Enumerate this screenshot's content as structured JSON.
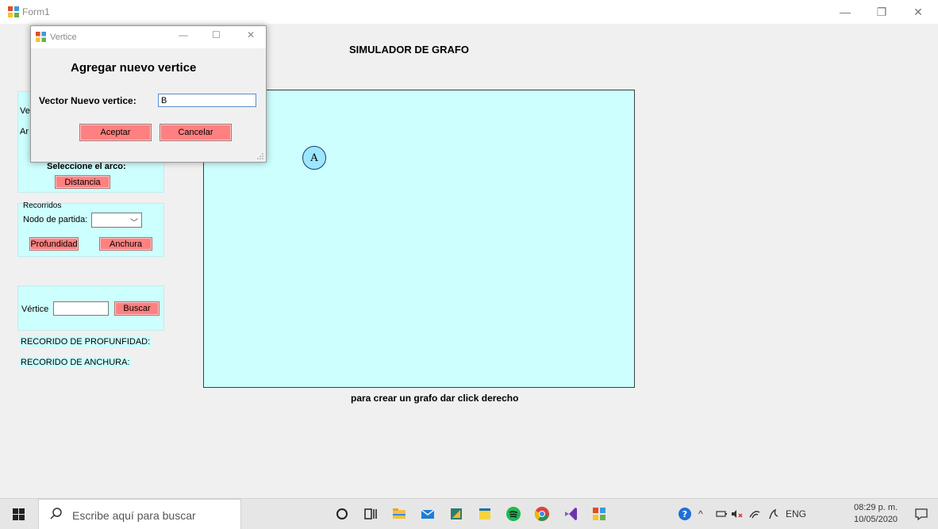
{
  "main_window": {
    "title": "Form1",
    "heading": "SIMULADOR DE GRAFO",
    "hint": "para crear un grafo dar click derecho",
    "min_glyph": "—",
    "max_glyph": "❐",
    "close_glyph": "✕"
  },
  "graph": {
    "nodes": [
      {
        "label": "A"
      }
    ]
  },
  "left_panel": {
    "vertices_label_partial": "Ve",
    "arcos_label_partial": "Ar",
    "select_arc_label": "Seleccione el arco:",
    "distance_button": "Distancia",
    "recorridos_title": "Recorridos",
    "start_node_label": "Nodo de partida:",
    "start_node_value": "",
    "depth_button": "Profundidad",
    "breadth_button": "Anchura",
    "vertex_label": "Vértice",
    "vertex_value": "",
    "search_button": "Buscar",
    "depth_result_label": "RECORIDO DE PROFUNFIDAD:",
    "breadth_result_label": "RECORIDO DE ANCHURA:"
  },
  "dialog": {
    "title": "Vertice",
    "heading": "Agregar nuevo vertice",
    "field_label": "Vector Nuevo vertice:",
    "field_value": "B",
    "accept_button": "Aceptar",
    "cancel_button": "Cancelar",
    "min_glyph": "—",
    "max_glyph": "☐",
    "close_glyph": "✕"
  },
  "taskbar": {
    "search_placeholder": "Escribe aquí para buscar",
    "language": "ENG",
    "time": "08:29 p. m.",
    "date": "10/05/2020"
  },
  "colors": {
    "canvas": "#ccfffe",
    "button": "#ff8080",
    "node": "#9de6ff"
  }
}
